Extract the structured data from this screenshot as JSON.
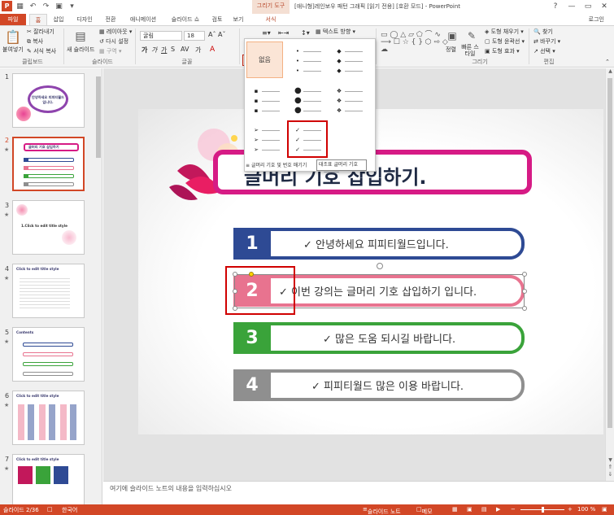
{
  "app": {
    "context_tool_label": "그리기 도구",
    "doc_title": "[애니형]레인보우 패턴 그래픽 [읽기 전용] [호환 모드] - PowerPoint",
    "login": "로그인",
    "window_controls": [
      "?",
      "—",
      "▭",
      "✕"
    ]
  },
  "tabs": [
    "파일",
    "홈",
    "삽입",
    "디자인",
    "전환",
    "애니메이션",
    "슬라이드 쇼",
    "검토",
    "보기",
    "서식"
  ],
  "ribbon": {
    "clipboard": {
      "label": "클립보드",
      "paste": "붙여넣기",
      "cut": "잘라내기",
      "copy": "복사",
      "format_painter": "서식 복사"
    },
    "slides": {
      "label": "슬라이드",
      "new_slide": "새 슬라이드",
      "layout": "레이아웃",
      "reset": "다시 설정",
      "section": "구역"
    },
    "font": {
      "label": "글꼴",
      "font_name": "굴림",
      "font_size": "18"
    },
    "paragraph": {
      "text_direction": "텍스트 방향"
    },
    "drawing": {
      "label": "그리기",
      "arrange": "정렬",
      "quick_styles": "빠른 스타일",
      "shape_fill": "도형 채우기",
      "shape_outline": "도형 윤곽선",
      "shape_effects": "도형 효과"
    },
    "editing": {
      "label": "편집",
      "find": "찾기",
      "replace": "바꾸기",
      "select": "선택"
    }
  },
  "bullet_dropdown": {
    "none_label": "없음",
    "footer_label": "글머리 기호 및 번호 매기기",
    "tooltip": "대조표 글머리 기호"
  },
  "thumbnails": [
    {
      "num": "1",
      "title": "안녕하세요 피피티월드 입니다."
    },
    {
      "num": "2",
      "title": "글머리 기호 삽입하기"
    },
    {
      "num": "3",
      "title": "1.Click to edit title style"
    },
    {
      "num": "4",
      "title": "Click to edit title style"
    },
    {
      "num": "5",
      "title": "Contents"
    },
    {
      "num": "6",
      "title": "Click to edit title style"
    },
    {
      "num": "7",
      "title": "Click to edit title style"
    }
  ],
  "slide": {
    "title": "글머리 기호 삽입하기.",
    "items": [
      {
        "num": "1",
        "text": "✓ 안녕하세요 피피티월드입니다.",
        "color": "#2e4a94"
      },
      {
        "num": "2",
        "text": "✓ 이번 강의는 글머리 기호 삽입하기 입니다.",
        "color": "#e8738f"
      },
      {
        "num": "3",
        "text": "✓ 많은 도움 되시길 바랍니다.",
        "color": "#3aa33a"
      },
      {
        "num": "4",
        "text": "✓ 피피티월드 많은 이용 바랍니다.",
        "color": "#8f8f8f"
      }
    ]
  },
  "notes_placeholder": "여기에 슬라이드 노트의 내용을 입력하십시오",
  "status": {
    "slide_count": "슬라이드 2/36",
    "language": "한국어",
    "notes_btn": "슬라이드 노트",
    "comments_btn": "메모",
    "zoom": "100 %"
  }
}
